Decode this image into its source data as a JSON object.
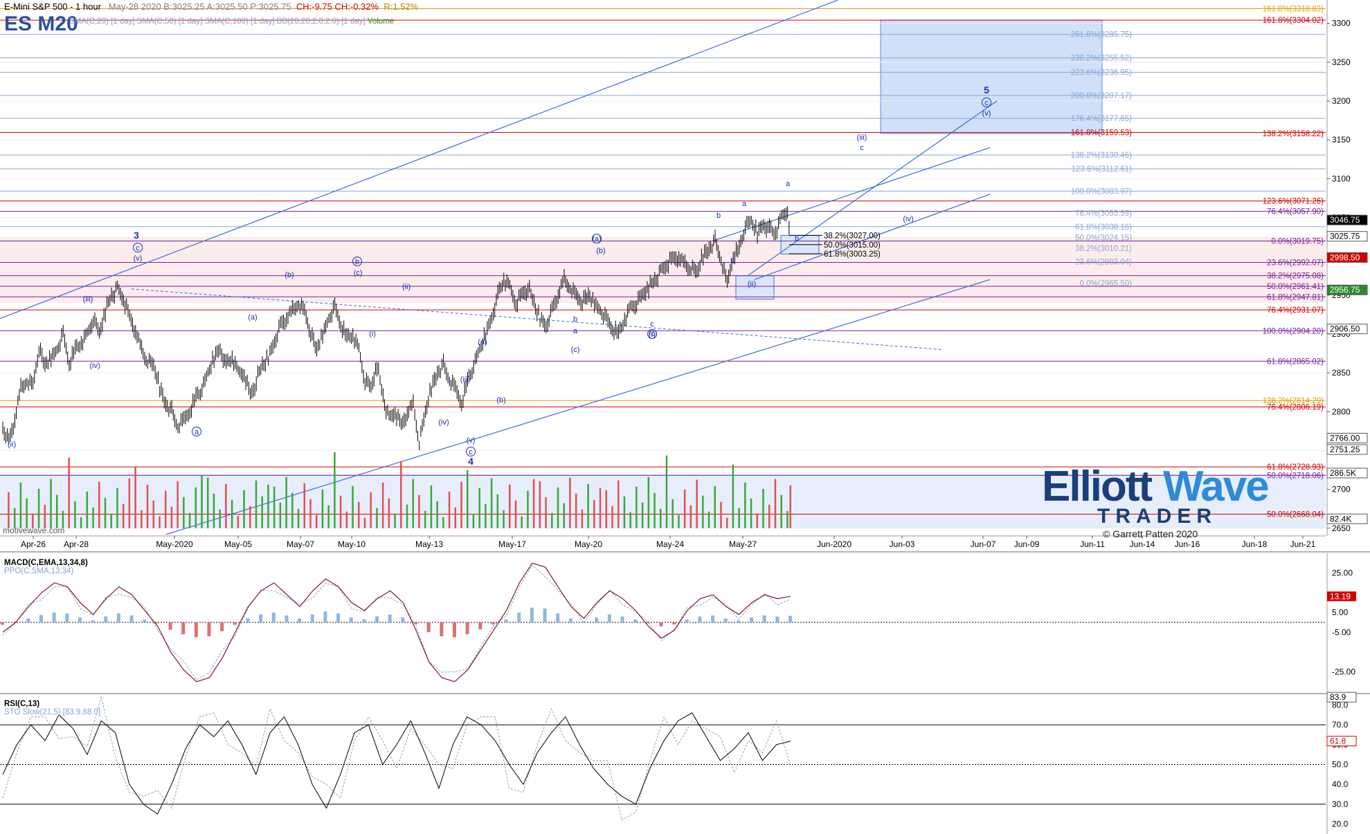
{
  "header": {
    "title": "E-Mini S&P 500 - 1 hour",
    "quote": "May-28 2020  B:3025.25  A:3025.50  P:3025.75",
    "change": "CH:-9.75  CH:-0.32%",
    "range": "R:1.52%",
    "symbol": "ES M20",
    "indicators": "SMA(C,20) [1 day]  SMA(C,50) [1 day]  SMA(C,100) [1 day]  BB(20,20,2.0,2.0) [1 day]",
    "volume_label": "Volume"
  },
  "panels": {
    "macd_title": "MACD(C,EMA,13,34,8)",
    "macd_sub": "PPO(C,SMA,13,34)",
    "rsi_title": "RSI(C,13)",
    "rsi_sub": "STO Slow(21,5) [83.9,88.0]"
  },
  "watermark": {
    "brand_a": "Elliott",
    "brand_b": "Wave",
    "brand_c": "TRADER",
    "copyright": "© Garrett Patten 2020",
    "platform": "motivewave.com"
  },
  "colors": {
    "price_bar": "#000000",
    "up_volume": "#3aa63a",
    "down_volume": "#e05050",
    "target_box": "#cfe0f8",
    "wave_label": "#1a2fb5",
    "fib_red": "#d40000",
    "fib_purple": "#7a1fa2",
    "fib_blue": "#8aa8d0",
    "channel": "#3a6fd8",
    "macd_line": "#7a1e1e",
    "ppo_line": "#8aa0d0",
    "rsi_line": "#000000"
  },
  "chart_data": [
    {
      "type": "line",
      "title": "E-Mini S&P 500 - 1 hour",
      "ylabel": "",
      "ylim": [
        2640,
        3330
      ],
      "x_ticks": [
        "Apr-26",
        "Apr-28",
        "May-2020",
        "May-05",
        "May-07",
        "May-10",
        "May-13",
        "May-17",
        "May-20",
        "May-24",
        "May-27",
        "Jun-2020",
        "Jun-03",
        "Jun-07",
        "Jun-09",
        "Jun-11",
        "Jun-14",
        "Jun-16",
        "Jun-18",
        "Jun-21"
      ],
      "y_ticks": [
        2650,
        2700,
        2750,
        2800,
        2850,
        2900,
        2950,
        3000,
        3050,
        3100,
        3150,
        3200,
        3250,
        3300
      ],
      "price_path": [
        [
          0,
          2780
        ],
        [
          2,
          2760
        ],
        [
          4,
          2790
        ],
        [
          6,
          2830
        ],
        [
          8,
          2840
        ],
        [
          10,
          2835
        ],
        [
          12,
          2880
        ],
        [
          14,
          2860
        ],
        [
          16,
          2870
        ],
        [
          18,
          2880
        ],
        [
          20,
          2900
        ],
        [
          22,
          2860
        ],
        [
          24,
          2880
        ],
        [
          26,
          2890
        ],
        [
          28,
          2900
        ],
        [
          30,
          2920
        ],
        [
          32,
          2900
        ],
        [
          34,
          2930
        ],
        [
          36,
          2950
        ],
        [
          38,
          2958
        ],
        [
          40,
          2945
        ],
        [
          42,
          2920
        ],
        [
          44,
          2905
        ],
        [
          46,
          2880
        ],
        [
          48,
          2865
        ],
        [
          50,
          2860
        ],
        [
          52,
          2830
        ],
        [
          54,
          2810
        ],
        [
          56,
          2800
        ],
        [
          58,
          2780
        ],
        [
          60,
          2790
        ],
        [
          62,
          2800
        ],
        [
          64,
          2820
        ],
        [
          66,
          2830
        ],
        [
          68,
          2850
        ],
        [
          70,
          2870
        ],
        [
          72,
          2880
        ],
        [
          74,
          2860
        ],
        [
          76,
          2870
        ],
        [
          78,
          2850
        ],
        [
          80,
          2850
        ],
        [
          82,
          2820
        ],
        [
          84,
          2840
        ],
        [
          86,
          2860
        ],
        [
          88,
          2870
        ],
        [
          90,
          2890
        ],
        [
          92,
          2910
        ],
        [
          94,
          2920
        ],
        [
          96,
          2930
        ],
        [
          98,
          2940
        ],
        [
          100,
          2930
        ],
        [
          102,
          2900
        ],
        [
          104,
          2880
        ],
        [
          106,
          2900
        ],
        [
          108,
          2920
        ],
        [
          110,
          2935
        ],
        [
          112,
          2910
        ],
        [
          114,
          2895
        ],
        [
          116,
          2900
        ],
        [
          118,
          2880
        ],
        [
          120,
          2840
        ],
        [
          122,
          2830
        ],
        [
          124,
          2860
        ],
        [
          126,
          2820
        ],
        [
          128,
          2790
        ],
        [
          130,
          2800
        ],
        [
          132,
          2780
        ],
        [
          134,
          2800
        ],
        [
          136,
          2810
        ],
        [
          138,
          2760
        ],
        [
          140,
          2800
        ],
        [
          142,
          2830
        ],
        [
          144,
          2850
        ],
        [
          146,
          2860
        ],
        [
          148,
          2840
        ],
        [
          150,
          2830
        ],
        [
          152,
          2810
        ],
        [
          154,
          2840
        ],
        [
          156,
          2860
        ],
        [
          158,
          2880
        ],
        [
          160,
          2900
        ],
        [
          162,
          2920
        ],
        [
          164,
          2950
        ],
        [
          166,
          2970
        ],
        [
          168,
          2960
        ],
        [
          170,
          2940
        ],
        [
          172,
          2950
        ],
        [
          174,
          2960
        ],
        [
          176,
          2940
        ],
        [
          178,
          2920
        ],
        [
          180,
          2910
        ],
        [
          182,
          2930
        ],
        [
          184,
          2950
        ],
        [
          186,
          2970
        ],
        [
          188,
          2960
        ],
        [
          190,
          2950
        ],
        [
          192,
          2940
        ],
        [
          194,
          2950
        ],
        [
          196,
          2940
        ],
        [
          198,
          2930
        ],
        [
          200,
          2920
        ],
        [
          202,
          2905
        ],
        [
          204,
          2900
        ],
        [
          206,
          2920
        ],
        [
          208,
          2935
        ],
        [
          210,
          2940
        ],
        [
          212,
          2950
        ],
        [
          214,
          2960
        ],
        [
          216,
          2970
        ],
        [
          218,
          2980
        ],
        [
          220,
          2990
        ],
        [
          222,
          2995
        ],
        [
          224,
          3000
        ],
        [
          226,
          2990
        ],
        [
          228,
          2985
        ],
        [
          230,
          2980
        ],
        [
          232,
          3000
        ],
        [
          234,
          3010
        ],
        [
          236,
          3020
        ],
        [
          238,
          2995
        ],
        [
          240,
          2965
        ],
        [
          242,
          3000
        ],
        [
          244,
          3010
        ],
        [
          246,
          3040
        ],
        [
          248,
          3045
        ],
        [
          250,
          3030
        ],
        [
          252,
          3040
        ],
        [
          254,
          3035
        ],
        [
          256,
          3030
        ],
        [
          258,
          3050
        ],
        [
          260,
          3060
        ],
        [
          261,
          3025
        ]
      ],
      "annotations": {
        "wave_labels": [
          "3",
          "c",
          "(v)",
          "(iii)",
          "(iv)",
          "(ii)",
          "a",
          "(a)",
          "(b)",
          "b",
          "(c)",
          "(i)",
          "(ii)",
          "(iv)",
          "(iii)",
          "(v)",
          "c",
          "4",
          "(a)",
          "(b)",
          "b",
          "a",
          "(c)",
          "(a)",
          "(b)",
          "(c)",
          "c",
          "(i)",
          "b",
          "a",
          "c",
          "(ii)",
          "(iii)",
          "c",
          "5",
          "c",
          "(v)",
          "(iv)",
          "a",
          "b"
        ],
        "fib_left": [
          "38.2%(3027.00)",
          "50.0%(3015.00)",
          "61.8%(3003.25)"
        ],
        "fib_right_labels": [
          "161.8%(3318.83)",
          "161.8%(3304.02)",
          "261.8%(3285.75)",
          "238.2%(3255.52)",
          "223.6%(3236.95)",
          "200.0%(3207.17)",
          "176.4%(3177.65)",
          "161.8%(3159.53)",
          "138.2%(3158.22)",
          "138.2%(3130.46)",
          "123.6%(3112.61)",
          "100.0%(3083.97)",
          "123.6%(3071.26)",
          "76.4%(3057.90)",
          "76.4%(3055.59)",
          "61.8%(3038.16)",
          "50.0%(3024.15)",
          "0.0%(3019.75)",
          "38.2%(3010.21)",
          "23.6%(2993.04)",
          "23.6%(2992.07)",
          "38.2%(2975.08)",
          "0.0%(2965.50)",
          "50.0%(2961.41)",
          "61.8%(2947.81)",
          "76.4%(2931.07)",
          "100.0%(2904.20)",
          "61.8%(2865.02)",
          "138.2%(2814.29)",
          "76.4%(2806.19)",
          "61.8%(2728.93)",
          "50.0%(2718.06)",
          "50.0%(2668.04)"
        ],
        "axis_tags": [
          "3046.75",
          "3025.75",
          "2998.50",
          "2956.75",
          "2906.50",
          "2766.00",
          "2751.25",
          "286.5K",
          "82.4K"
        ]
      }
    },
    {
      "type": "line",
      "title": "MACD(C,EMA,13,34,8)",
      "ylim": [
        -35,
        35
      ],
      "y_ticks": [
        25,
        5,
        -5,
        -25
      ],
      "series": [
        {
          "values": [
            -5,
            0,
            8,
            15,
            20,
            18,
            10,
            4,
            12,
            18,
            14,
            6,
            -2,
            -15,
            -24,
            -30,
            -28,
            -18,
            -5,
            8,
            16,
            20,
            14,
            8,
            16,
            22,
            18,
            10,
            6,
            12,
            16,
            10,
            -4,
            -20,
            -28,
            -30,
            -24,
            -14,
            -4,
            6,
            20,
            30,
            28,
            18,
            8,
            2,
            10,
            16,
            12,
            6,
            -2,
            -8,
            -4,
            6,
            12,
            14,
            8,
            4,
            10,
            14,
            12,
            13.19
          ]
        }
      ],
      "current_value": "13.19"
    },
    {
      "type": "line",
      "title": "RSI(C,13)",
      "ylim": [
        15,
        85
      ],
      "y_ticks": [
        80,
        70,
        60,
        50,
        40,
        30,
        20
      ],
      "series": [
        {
          "values": [
            45,
            60,
            70,
            62,
            75,
            68,
            55,
            72,
            66,
            40,
            30,
            25,
            40,
            58,
            70,
            64,
            72,
            60,
            45,
            66,
            74,
            60,
            40,
            28,
            45,
            66,
            70,
            50,
            60,
            72,
            56,
            38,
            60,
            74,
            70,
            62,
            50,
            40,
            56,
            66,
            74,
            60,
            48,
            40,
            34,
            30,
            48,
            62,
            72,
            76,
            64,
            52,
            58,
            66,
            52,
            60,
            61.8
          ]
        }
      ],
      "current_value": "61.8",
      "sto_value": "83.9"
    }
  ]
}
